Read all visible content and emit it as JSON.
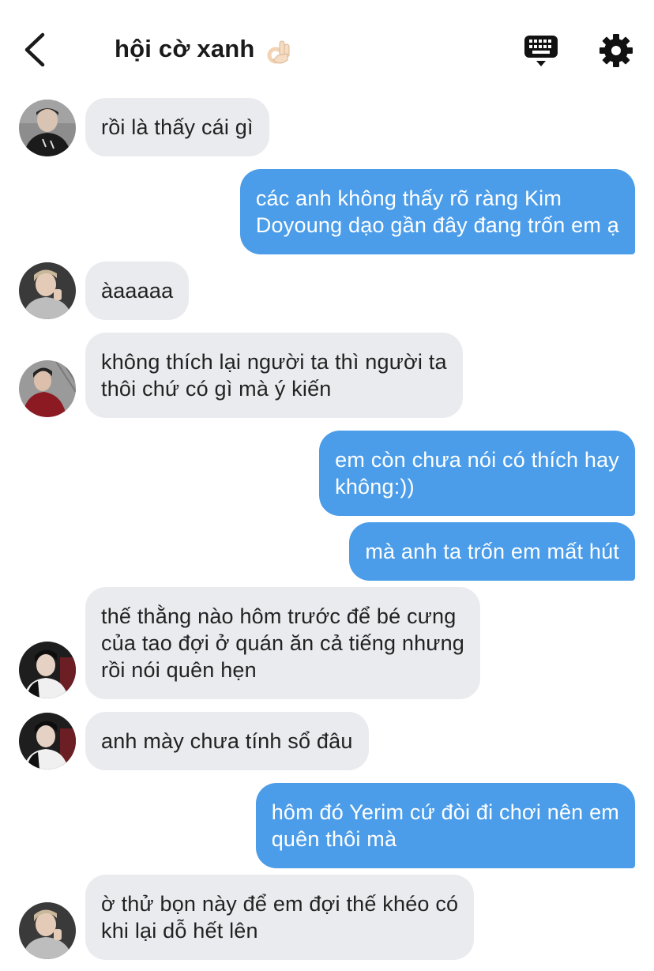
{
  "header": {
    "title": "hội cờ xanh",
    "title_emoji": "ok-hand-emoji",
    "back_icon": "chevron-left-icon",
    "keyboard_icon": "keyboard-icon",
    "settings_icon": "gear-icon"
  },
  "colors": {
    "incoming_bubble": "#e9ebee",
    "outgoing_bubble": "#4b9de9",
    "incoming_text": "#222222",
    "outgoing_text": "#ffffff"
  },
  "messages": [
    {
      "direction": "incoming",
      "avatar": "avatar-black-jacket",
      "text": "rồi là thấy cái gì"
    },
    {
      "direction": "outgoing",
      "text": "các anh không thấy rõ ràng Kim\nDoyoung dạo gần đây đang trốn em ạ"
    },
    {
      "direction": "incoming",
      "avatar": "avatar-grey-hoodie",
      "text": "àaaaaa"
    },
    {
      "direction": "incoming",
      "avatar": "avatar-red-jacket",
      "text": "không thích lại người ta thì người ta\nthôi chứ có gì mà ý kiến"
    },
    {
      "direction": "outgoing",
      "text": "em còn chưa nói có thích hay\nkhông:))"
    },
    {
      "direction": "outgoing",
      "text": "mà anh ta trốn em mất hút"
    },
    {
      "direction": "incoming",
      "avatar": "avatar-dark-hair",
      "text": "thế thằng nào hôm trước để bé cưng\ncủa tao đợi ở quán ăn cả tiếng nhưng\nrồi nói quên hẹn"
    },
    {
      "direction": "incoming",
      "avatar": "avatar-dark-hair",
      "text": "anh mày chưa tính sổ đâu"
    },
    {
      "direction": "outgoing",
      "text": "hôm đó Yerim cứ đòi đi chơi nên em\nquên thôi mà"
    },
    {
      "direction": "incoming",
      "avatar": "avatar-grey-hoodie",
      "text": "ờ thử bọn này để em đợi thế khéo có\nkhi lại dỗ hết lên"
    }
  ]
}
